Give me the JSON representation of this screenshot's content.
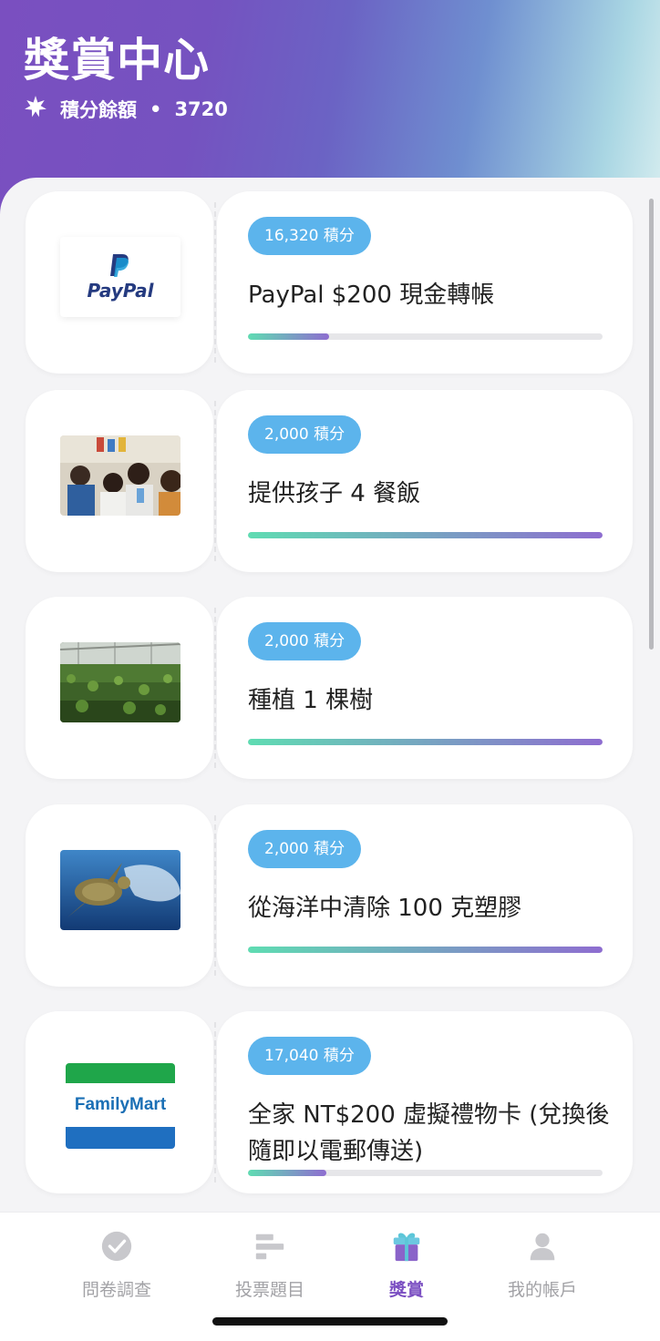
{
  "header": {
    "title": "獎賞中心",
    "balance_label": "積分餘額",
    "separator": "•",
    "balance_value": "3720",
    "balance_icon": "sparkle-icon"
  },
  "rewards": [
    {
      "points": "16,320 積分",
      "name": "PayPal $200 現金轉帳",
      "progress": 0.23,
      "image": "paypal-logo",
      "logo_text": "PayPal"
    },
    {
      "points": "2,000 積分",
      "name": "提供孩子 4 餐飯",
      "progress": 1.0,
      "image": "children-photo"
    },
    {
      "points": "2,000 積分",
      "name": "種植 1 棵樹",
      "progress": 1.0,
      "image": "tree-nursery-photo"
    },
    {
      "points": "2,000 積分",
      "name": "從海洋中清除 100 克塑膠",
      "progress": 1.0,
      "image": "sea-turtle-photo"
    },
    {
      "points": "17,040 積分",
      "name": "全家 NT$200 虛擬禮物卡 (兌換後隨即以電郵傳送)",
      "progress": 0.22,
      "image": "familymart-logo",
      "logo_text": "FamilyMart"
    }
  ],
  "nav": [
    {
      "label": "問卷調查",
      "icon": "check-circle-icon",
      "active": false
    },
    {
      "label": "投票題目",
      "icon": "bar-list-icon",
      "active": false
    },
    {
      "label": "獎賞",
      "icon": "gift-icon",
      "active": true
    },
    {
      "label": "我的帳戶",
      "icon": "user-icon",
      "active": false
    }
  ],
  "colors": {
    "accent": "#7b4fc2",
    "pill": "#5cb4ec",
    "progress_start": "#5fdcb2",
    "progress_end": "#8e6dd0"
  }
}
